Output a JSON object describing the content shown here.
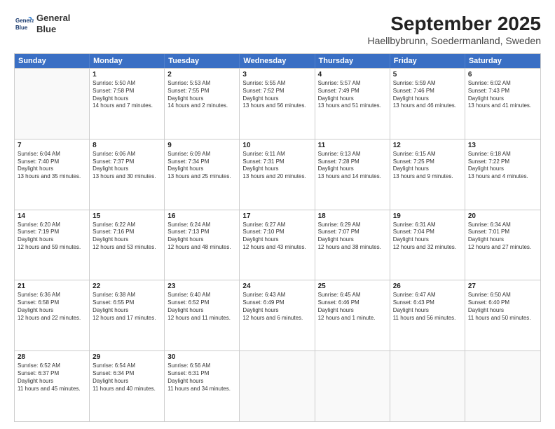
{
  "header": {
    "logo_line1": "General",
    "logo_line2": "Blue",
    "title": "September 2025",
    "subtitle": "Haellbybrunn, Soedermanland, Sweden"
  },
  "days_of_week": [
    "Sunday",
    "Monday",
    "Tuesday",
    "Wednesday",
    "Thursday",
    "Friday",
    "Saturday"
  ],
  "weeks": [
    [
      {
        "day": "",
        "empty": true
      },
      {
        "day": "1",
        "sunrise": "5:50 AM",
        "sunset": "7:58 PM",
        "daylight": "14 hours and 7 minutes."
      },
      {
        "day": "2",
        "sunrise": "5:53 AM",
        "sunset": "7:55 PM",
        "daylight": "14 hours and 2 minutes."
      },
      {
        "day": "3",
        "sunrise": "5:55 AM",
        "sunset": "7:52 PM",
        "daylight": "13 hours and 56 minutes."
      },
      {
        "day": "4",
        "sunrise": "5:57 AM",
        "sunset": "7:49 PM",
        "daylight": "13 hours and 51 minutes."
      },
      {
        "day": "5",
        "sunrise": "5:59 AM",
        "sunset": "7:46 PM",
        "daylight": "13 hours and 46 minutes."
      },
      {
        "day": "6",
        "sunrise": "6:02 AM",
        "sunset": "7:43 PM",
        "daylight": "13 hours and 41 minutes."
      }
    ],
    [
      {
        "day": "7",
        "sunrise": "6:04 AM",
        "sunset": "7:40 PM",
        "daylight": "13 hours and 35 minutes."
      },
      {
        "day": "8",
        "sunrise": "6:06 AM",
        "sunset": "7:37 PM",
        "daylight": "13 hours and 30 minutes."
      },
      {
        "day": "9",
        "sunrise": "6:09 AM",
        "sunset": "7:34 PM",
        "daylight": "13 hours and 25 minutes."
      },
      {
        "day": "10",
        "sunrise": "6:11 AM",
        "sunset": "7:31 PM",
        "daylight": "13 hours and 20 minutes."
      },
      {
        "day": "11",
        "sunrise": "6:13 AM",
        "sunset": "7:28 PM",
        "daylight": "13 hours and 14 minutes."
      },
      {
        "day": "12",
        "sunrise": "6:15 AM",
        "sunset": "7:25 PM",
        "daylight": "13 hours and 9 minutes."
      },
      {
        "day": "13",
        "sunrise": "6:18 AM",
        "sunset": "7:22 PM",
        "daylight": "13 hours and 4 minutes."
      }
    ],
    [
      {
        "day": "14",
        "sunrise": "6:20 AM",
        "sunset": "7:19 PM",
        "daylight": "12 hours and 59 minutes."
      },
      {
        "day": "15",
        "sunrise": "6:22 AM",
        "sunset": "7:16 PM",
        "daylight": "12 hours and 53 minutes."
      },
      {
        "day": "16",
        "sunrise": "6:24 AM",
        "sunset": "7:13 PM",
        "daylight": "12 hours and 48 minutes."
      },
      {
        "day": "17",
        "sunrise": "6:27 AM",
        "sunset": "7:10 PM",
        "daylight": "12 hours and 43 minutes."
      },
      {
        "day": "18",
        "sunrise": "6:29 AM",
        "sunset": "7:07 PM",
        "daylight": "12 hours and 38 minutes."
      },
      {
        "day": "19",
        "sunrise": "6:31 AM",
        "sunset": "7:04 PM",
        "daylight": "12 hours and 32 minutes."
      },
      {
        "day": "20",
        "sunrise": "6:34 AM",
        "sunset": "7:01 PM",
        "daylight": "12 hours and 27 minutes."
      }
    ],
    [
      {
        "day": "21",
        "sunrise": "6:36 AM",
        "sunset": "6:58 PM",
        "daylight": "12 hours and 22 minutes."
      },
      {
        "day": "22",
        "sunrise": "6:38 AM",
        "sunset": "6:55 PM",
        "daylight": "12 hours and 17 minutes."
      },
      {
        "day": "23",
        "sunrise": "6:40 AM",
        "sunset": "6:52 PM",
        "daylight": "12 hours and 11 minutes."
      },
      {
        "day": "24",
        "sunrise": "6:43 AM",
        "sunset": "6:49 PM",
        "daylight": "12 hours and 6 minutes."
      },
      {
        "day": "25",
        "sunrise": "6:45 AM",
        "sunset": "6:46 PM",
        "daylight": "12 hours and 1 minute."
      },
      {
        "day": "26",
        "sunrise": "6:47 AM",
        "sunset": "6:43 PM",
        "daylight": "11 hours and 56 minutes."
      },
      {
        "day": "27",
        "sunrise": "6:50 AM",
        "sunset": "6:40 PM",
        "daylight": "11 hours and 50 minutes."
      }
    ],
    [
      {
        "day": "28",
        "sunrise": "6:52 AM",
        "sunset": "6:37 PM",
        "daylight": "11 hours and 45 minutes."
      },
      {
        "day": "29",
        "sunrise": "6:54 AM",
        "sunset": "6:34 PM",
        "daylight": "11 hours and 40 minutes."
      },
      {
        "day": "30",
        "sunrise": "6:56 AM",
        "sunset": "6:31 PM",
        "daylight": "11 hours and 34 minutes."
      },
      {
        "day": "",
        "empty": true
      },
      {
        "day": "",
        "empty": true
      },
      {
        "day": "",
        "empty": true
      },
      {
        "day": "",
        "empty": true
      }
    ]
  ]
}
